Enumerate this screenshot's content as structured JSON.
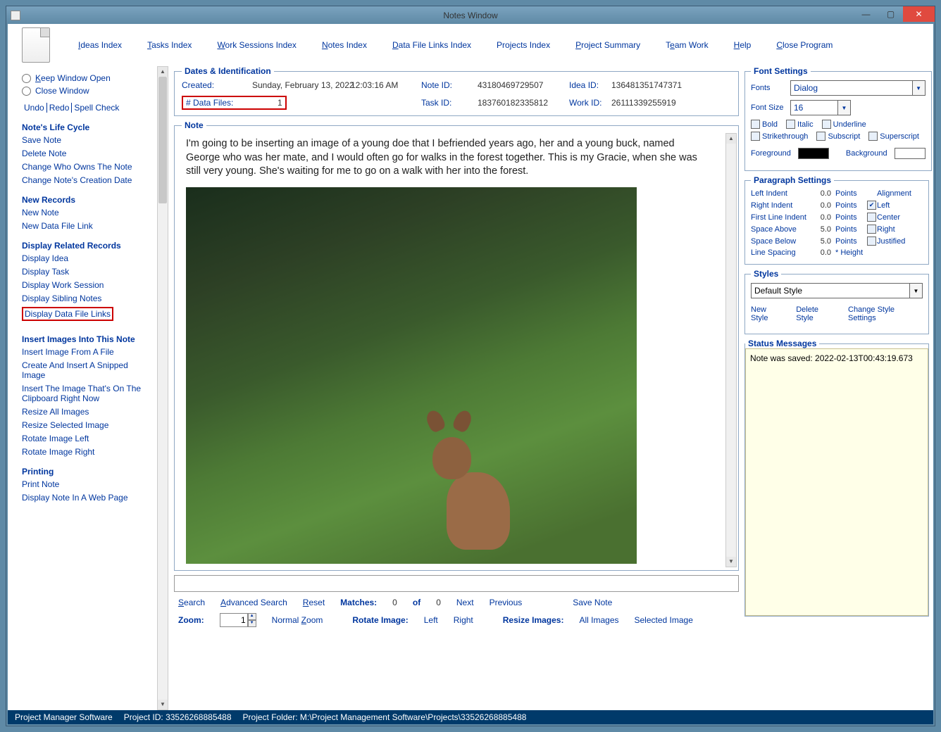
{
  "window": {
    "title": "Notes Window"
  },
  "menu": {
    "items": [
      "Ideas Index",
      "Tasks Index",
      "Work Sessions Index",
      "Notes Index",
      "Data File Links Index",
      "Projects Index",
      "Project Summary",
      "Team Work",
      "Help",
      "Close Program"
    ]
  },
  "sidebar": {
    "keepOpen": "Keep Window Open",
    "closeWin": "Close Window",
    "undo": "Undo",
    "redo": "Redo",
    "spell": "Spell Check",
    "life": {
      "heading": "Note's Life Cycle",
      "items": [
        "Save Note",
        "Delete Note",
        "Change Who Owns The Note",
        "Change Note's Creation Date"
      ]
    },
    "newrec": {
      "heading": "New Records",
      "items": [
        "New Note",
        "New Data File Link"
      ]
    },
    "display": {
      "heading": "Display Related Records",
      "items": [
        "Display Idea",
        "Display Task",
        "Display Work Session",
        "Display Sibling Notes",
        "Display Data File Links"
      ]
    },
    "insert": {
      "heading": "Insert Images Into This Note",
      "items": [
        "Insert Image From A File",
        "Create And Insert A Snipped Image",
        "Insert The Image That's On The Clipboard Right Now",
        "Resize All Images",
        "Resize Selected Image",
        "Rotate Image Left",
        "Rotate Image Right"
      ]
    },
    "printing": {
      "heading": "Printing",
      "items": [
        "Print Note",
        "Display Note In A Web Page"
      ]
    }
  },
  "dates": {
    "legend": "Dates & Identification",
    "createdLabel": "Created:",
    "createdDate": "Sunday, February 13, 2022",
    "createdTime": "12:03:16 AM",
    "dataFilesLabel": "# Data Files:",
    "dataFilesCount": "1",
    "noteIdLabel": "Note ID:",
    "noteId": "43180469729507",
    "ideaIdLabel": "Idea ID:",
    "ideaId": "136481351747371",
    "taskIdLabel": "Task ID:",
    "taskId": "183760182335812",
    "workIdLabel": "Work ID:",
    "workId": "26111339255919"
  },
  "note": {
    "legend": "Note",
    "text": "I'm going to be inserting an image of a young doe that I befriended years ago, her and a young buck, named George who was her mate, and I would often go for walks in the forest together. This is my Gracie, when she was still very young. She's waiting for me to go on a walk with her into the forest."
  },
  "search": {
    "search": "Search",
    "advanced": "Advanced Search",
    "reset": "Reset",
    "matchesLabel": "Matches:",
    "matches": "0",
    "ofLabel": "of",
    "ofVal": "0",
    "next": "Next",
    "previous": "Previous",
    "save": "Save Note"
  },
  "zoomRow": {
    "zoomLabel": "Zoom:",
    "zoomVal": "1",
    "normal": "Normal Zoom",
    "rotateLabel": "Rotate Image:",
    "left": "Left",
    "right": "Right",
    "resizeLabel": "Resize Images:",
    "all": "All Images",
    "selected": "Selected Image"
  },
  "font": {
    "legend": "Font Settings",
    "fontsLabel": "Fonts",
    "fontsVal": "Dialog",
    "sizeLabel": "Font Size",
    "sizeVal": "16",
    "bold": "Bold",
    "italic": "Italic",
    "underline": "Underline",
    "strike": "Strikethrough",
    "sub": "Subscript",
    "sup": "Superscript",
    "fg": "Foreground",
    "bg": "Background",
    "fgColor": "#000000",
    "bgColor": "#ffffff"
  },
  "para": {
    "legend": "Paragraph Settings",
    "leftIndent": "Left Indent",
    "rightIndent": "Right Indent",
    "firstLine": "First Line Indent",
    "spaceAbove": "Space Above",
    "spaceBelow": "Space Below",
    "lineSpacing": "Line Spacing",
    "v0": "0.0",
    "v5": "5.0",
    "points": "Points",
    "height": "* Height",
    "alignLabel": "Alignment",
    "left": "Left",
    "center": "Center",
    "right": "Right",
    "just": "Justified"
  },
  "styles": {
    "legend": "Styles",
    "default": "Default Style",
    "new": "New Style",
    "delete": "Delete Style",
    "change": "Change Style Settings"
  },
  "status": {
    "legend": "Status Messages",
    "msg": "Note was saved:  2022-02-13T00:43:19.673"
  },
  "statusbar": {
    "app": "Project Manager Software",
    "projectIdLabel": "Project ID:",
    "projectId": " 33526268885488",
    "folderLabel": "Project Folder:",
    "folder": " M:\\Project Management Software\\Projects\\33526268885488"
  }
}
